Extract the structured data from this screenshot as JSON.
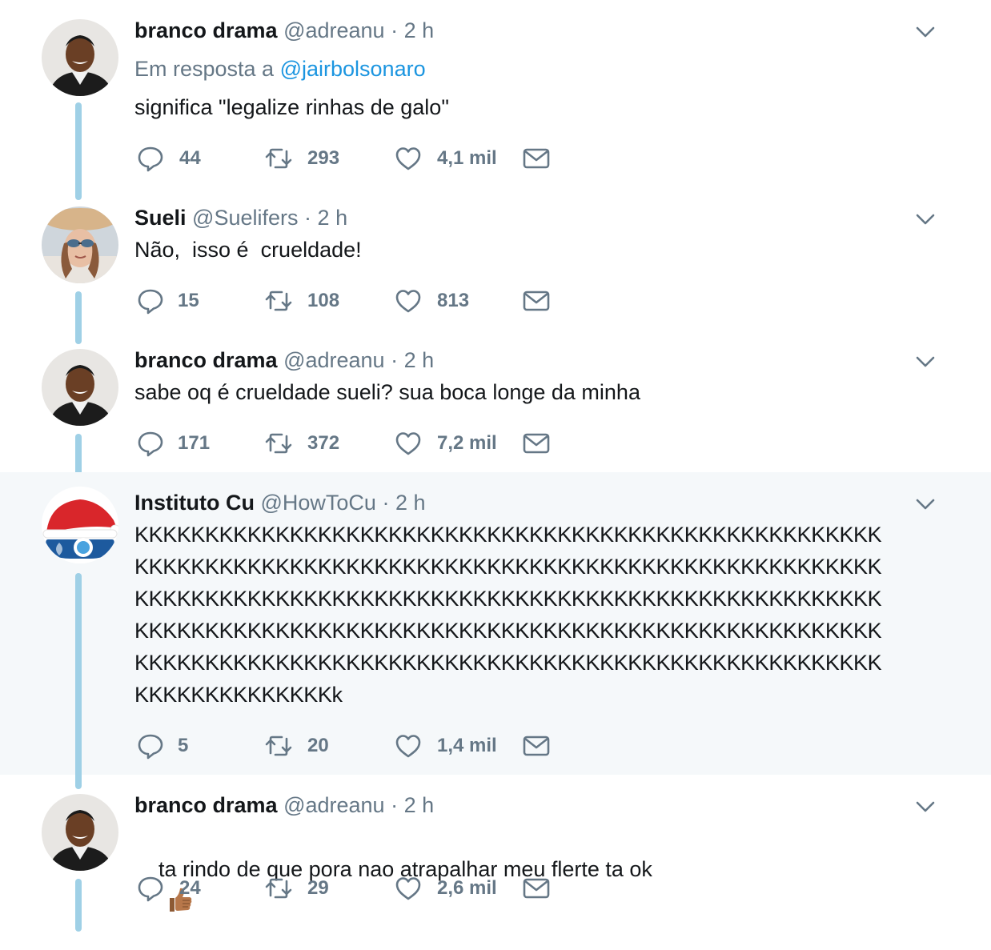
{
  "tweets": [
    {
      "name": "branco drama",
      "handle": "@adreanu",
      "dot": "·",
      "time": "2 h",
      "reply_prefix": "Em resposta a",
      "reply_mention": "@jairbolsonaro",
      "text": "significa \"legalize rinhas de galo\"",
      "replies": "44",
      "retweets": "293",
      "likes": "4,1 mil"
    },
    {
      "name": "Sueli",
      "handle": "@Suelifers",
      "dot": "·",
      "time": "2 h",
      "text": "Não,  isso é  crueldade!",
      "replies": "15",
      "retweets": "108",
      "likes": "813"
    },
    {
      "name": "branco drama",
      "handle": "@adreanu",
      "dot": "·",
      "time": "2 h",
      "text": "sabe oq é crueldade sueli? sua boca longe da minha",
      "replies": "171",
      "retweets": "372",
      "likes": "7,2 mil"
    },
    {
      "name": "Instituto Cu",
      "handle": "@HowToCu",
      "dot": "·",
      "time": "2 h",
      "text_lines": [
        "KKKKKKKKKKKKKKKKKKKKKKKKKKKKKKKKKKKKKKKKKKKKKKKKKKKKK",
        "KKKKKKKKKKKKKKKKKKKKKKKKKKKKKKKKKKKKKKKKKKKKKKKKKKKKK",
        "KKKKKKKKKKKKKKKKKKKKKKKKKKKKKKKKKKKKKKKKKKKKKKKKKKKKK",
        "KKKKKKKKKKKKKKKKKKKKKKKKKKKKKKKKKKKKKKKKKKKKKKKKKKKKK",
        "KKKKKKKKKKKKKKKKKKKKKKKKKKKKKKKKKKKKKKKKKKKKKKKKKKKKK",
        "KKKKKKKKKKKKKKk"
      ],
      "replies": "5",
      "retweets": "20",
      "likes": "1,4 mil"
    },
    {
      "name": "branco drama",
      "handle": "@adreanu",
      "dot": "·",
      "time": "2 h",
      "text": "ta rindo de que pora nao atrapalhar meu flerte ta ok",
      "emoji": "thumbs-up",
      "replies": "24",
      "retweets": "29",
      "likes": "2,6 mil"
    }
  ],
  "colors": {
    "thread_line": "#9fd0e6",
    "muted": "#657786",
    "mention": "#1b95e0",
    "highlight_bg": "#f5f8fa"
  },
  "icons": [
    "reply-icon",
    "retweet-icon",
    "like-icon",
    "direct-message-icon",
    "chevron-down-icon"
  ]
}
